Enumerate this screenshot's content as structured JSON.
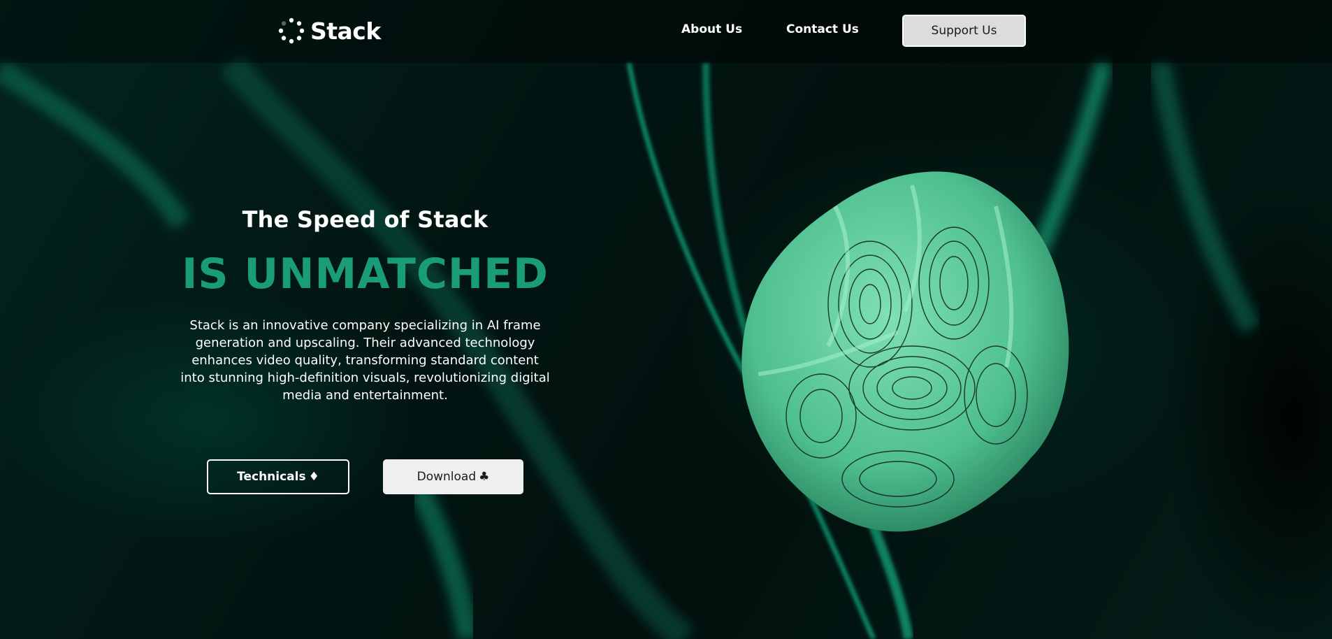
{
  "brand": {
    "name": "Stack",
    "icon": "spinner-dots-icon"
  },
  "nav": {
    "about_label": "About Us",
    "contact_label": "Contact Us",
    "support_label": "Support Us"
  },
  "hero": {
    "subtitle": "The Speed of Stack",
    "title": "IS UNMATCHED",
    "description": "Stack is an innovative company specializing in AI frame generation and upscaling. Their advanced technology enhances video quality, transforming standard content into stunning high-definition visuals, revolutionizing digital media and entertainment.",
    "technicals_label": "Technicals",
    "technicals_icon_glyph": "♦",
    "download_label": "Download",
    "download_icon_glyph": "♣"
  },
  "colors": {
    "accent": "#1a9c78",
    "background": "#020d0b",
    "support_button": "#dcdcdc",
    "download_button": "#efefef"
  }
}
